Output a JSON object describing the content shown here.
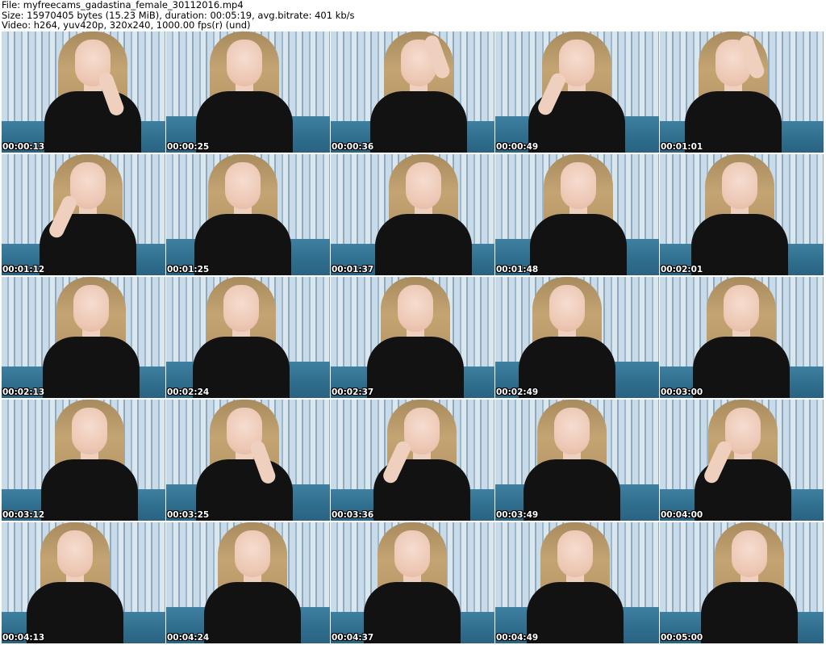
{
  "header": {
    "file_line": "File: myfreecams_gadastina_female_30112016.mp4",
    "size_line": "Size: 15970405 bytes (15.23 MiB), duration: 00:05:19, avg.bitrate: 401 kb/s",
    "video_line": "Video: h264, yuv420p, 320x240, 1000.00 fps(r) (und)"
  },
  "thumbnails": [
    "00:00:13",
    "00:00:25",
    "00:00:36",
    "00:00:49",
    "00:01:01",
    "00:01:12",
    "00:01:25",
    "00:01:37",
    "00:01:48",
    "00:02:01",
    "00:02:13",
    "00:02:24",
    "00:02:37",
    "00:02:49",
    "00:03:00",
    "00:03:12",
    "00:03:25",
    "00:03:36",
    "00:03:49",
    "00:04:00",
    "00:04:13",
    "00:04:24",
    "00:04:37",
    "00:04:49",
    "00:05:00"
  ],
  "colors": {
    "background": "#ffffff",
    "timestamp_text": "#ffffff",
    "timestamp_outline": "#000000",
    "dress": "#121212",
    "sofa": "#2f6d8c"
  }
}
